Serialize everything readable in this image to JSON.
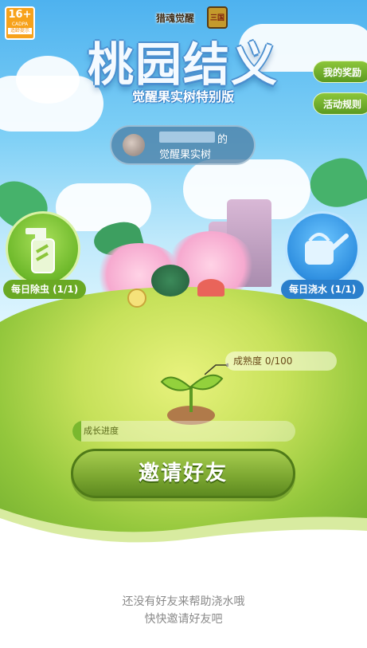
{
  "age_rating": {
    "number": "16+",
    "code": "CADPA",
    "text": "适龄提示"
  },
  "game_logo": "猎魂觉醒",
  "game_logo_2": "三国",
  "title": "桃园结义",
  "subtitle": "觉醒果实树特别版",
  "side_buttons": {
    "rewards": "我的奖励",
    "rules": "活动规则"
  },
  "owner": {
    "suffix": "的",
    "tree_label": "觉醒果实树"
  },
  "tasks": {
    "debug": {
      "label": "每日除虫 (1/1)",
      "icon": "spray-bottle-icon",
      "color": "#7cc22e"
    },
    "water": {
      "label": "每日浇水 (1/1)",
      "icon": "watering-can-icon",
      "color": "#2f8fe0"
    }
  },
  "maturity": {
    "label": "成熟度",
    "value": "0/100",
    "fraction": 0
  },
  "growth": {
    "label": "成长进度",
    "fraction": 0.04
  },
  "invite_button": "邀请好友",
  "tip": {
    "line1": "还没有好友来帮助浇水哦",
    "line2": "快快邀请好友吧"
  }
}
